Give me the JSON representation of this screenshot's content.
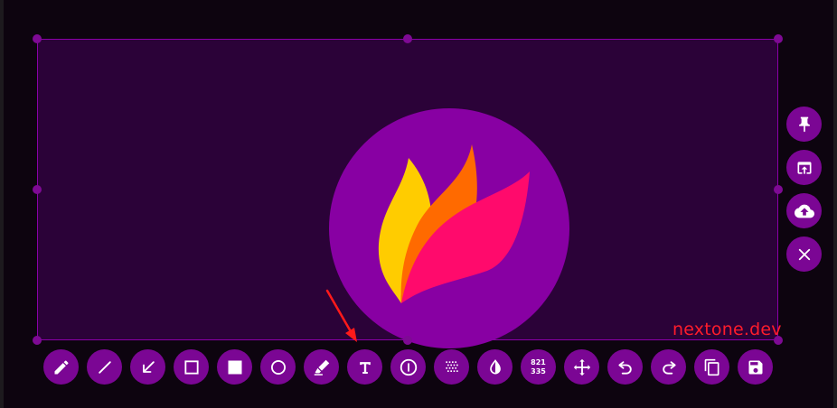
{
  "watermark": {
    "text": "nextone.dev",
    "color": "#ff1c2b"
  },
  "colors": {
    "selection_fill": "#2b0238",
    "button_bg": "#7b0694",
    "logo_circle": "#8800a3",
    "flame_yellow": "#ffcc00",
    "flame_orange": "#ff6a00",
    "flame_pink": "#ff0a6c",
    "annotation_arrow": "#ff1a1a"
  },
  "bottom_toolbar": {
    "tools": [
      {
        "name": "pencil",
        "icon": "pencil-icon"
      },
      {
        "name": "line",
        "icon": "line-icon"
      },
      {
        "name": "arrow",
        "icon": "arrow-icon"
      },
      {
        "name": "rectangle-outline",
        "icon": "square-outline-icon"
      },
      {
        "name": "rectangle-filled",
        "icon": "square-filled-icon"
      },
      {
        "name": "circle",
        "icon": "circle-outline-icon"
      },
      {
        "name": "marker",
        "icon": "marker-icon"
      },
      {
        "name": "text",
        "icon": "text-icon"
      },
      {
        "name": "counter",
        "icon": "numbered-circle-icon"
      },
      {
        "name": "pixelate",
        "icon": "pixelate-icon"
      },
      {
        "name": "invert",
        "icon": "invert-icon"
      },
      {
        "name": "selection-size",
        "icon": "size-readout",
        "width_text": "821",
        "height_text": "335"
      },
      {
        "name": "move",
        "icon": "move-icon"
      },
      {
        "name": "undo",
        "icon": "undo-icon"
      },
      {
        "name": "redo",
        "icon": "redo-icon"
      },
      {
        "name": "copy",
        "icon": "copy-icon"
      },
      {
        "name": "save",
        "icon": "save-icon"
      }
    ]
  },
  "side_toolbar": {
    "tools": [
      {
        "name": "pin",
        "icon": "pin-icon"
      },
      {
        "name": "open-app",
        "icon": "open-app-icon"
      },
      {
        "name": "upload",
        "icon": "cloud-upload-icon"
      },
      {
        "name": "close",
        "icon": "close-icon"
      }
    ]
  }
}
